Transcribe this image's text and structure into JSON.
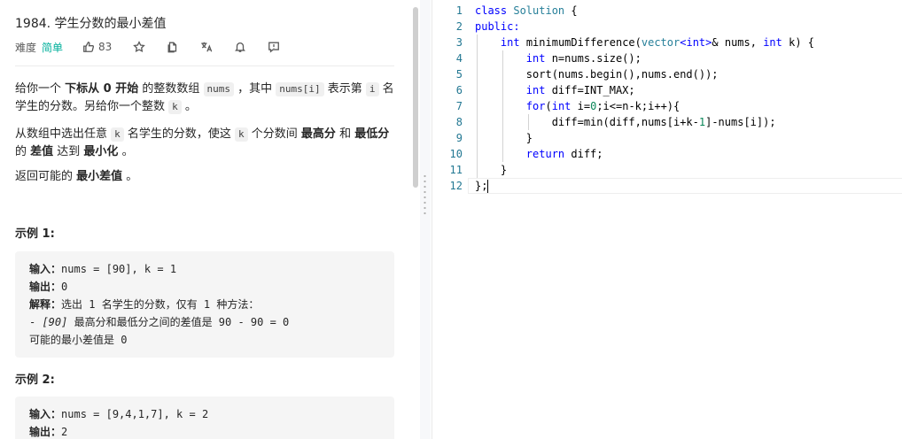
{
  "problem": {
    "title": "1984. 学生分数的最小差值",
    "difficulty_label": "难度",
    "difficulty": "简单",
    "likes": "83",
    "paragraph1": {
      "t1": "给你一个 ",
      "b1": "下标从 0 开始",
      "t2": " 的整数数组 ",
      "c1": "nums",
      "t3": " ，其中 ",
      "c2": "nums[i]",
      "t4": " 表示第 ",
      "c3": "i",
      "t5": " 名学生的分数。另给你一个整数 ",
      "c4": "k",
      "t6": " 。"
    },
    "paragraph2": {
      "t1": "从数组中选出任意 ",
      "c1": "k",
      "t2": " 名学生的分数，使这 ",
      "c2": "k",
      "t3": " 个分数间 ",
      "b1": "最高分",
      "t4": " 和 ",
      "b2": "最低分",
      "t5": " 的 ",
      "b3": "差值",
      "t6": " 达到 ",
      "b4": "最小化",
      "t7": " 。"
    },
    "paragraph3": {
      "t1": "返回可能的 ",
      "b1": "最小差值",
      "t2": " 。"
    },
    "example1": {
      "title": "示例 1:",
      "input_label": "输入：",
      "input": "nums = [90], k = 1",
      "output_label": "输出：",
      "output": "0",
      "explain_label": "解释：",
      "explain": "选出 1 名学生的分数，仅有 1 种方法：",
      "line4_a": "- ",
      "line4_i": "[90]",
      "line4_b": " 最高分和最低分之间的差值是 90 - 90 = 0",
      "line5": "可能的最小差值是 0"
    },
    "example2": {
      "title": "示例 2:",
      "input_label": "输入：",
      "input": "nums = [9,4,1,7], k = 2",
      "output_label": "输出：",
      "output": "2"
    }
  },
  "editor": {
    "line_numbers": [
      "1",
      "2",
      "3",
      "4",
      "5",
      "6",
      "7",
      "8",
      "9",
      "10",
      "11",
      "12"
    ],
    "code": {
      "l1_a": "class ",
      "l1_b": "Solution",
      "l1_c": " {",
      "l2": "public:",
      "l3_a": "    ",
      "l3_int1": "int",
      "l3_b": " minimumDifference(",
      "l3_vec": "vector",
      "l3_lt": "<",
      "l3_int2": "int",
      "l3_gt": ">",
      "l3_c": "& nums, ",
      "l3_int3": "int",
      "l3_d": " k) {",
      "l4_a": "        ",
      "l4_int": "int",
      "l4_b": " n=nums.size();",
      "l5": "        sort(nums.begin(),nums.end());",
      "l6_a": "        ",
      "l6_int": "int",
      "l6_b": " diff=INT_MAX;",
      "l7_a": "        ",
      "l7_for": "for",
      "l7_b": "(",
      "l7_int": "int",
      "l7_c": " i=",
      "l7_0": "0",
      "l7_d": ";i<=n-k;i++){",
      "l8_a": "            diff=min(diff,nums[i+k-",
      "l8_1": "1",
      "l8_b": "]-nums[i]);",
      "l9": "        }",
      "l10_a": "        ",
      "l10_ret": "return",
      "l10_b": " diff;",
      "l11": "    }",
      "l12": "};"
    }
  }
}
